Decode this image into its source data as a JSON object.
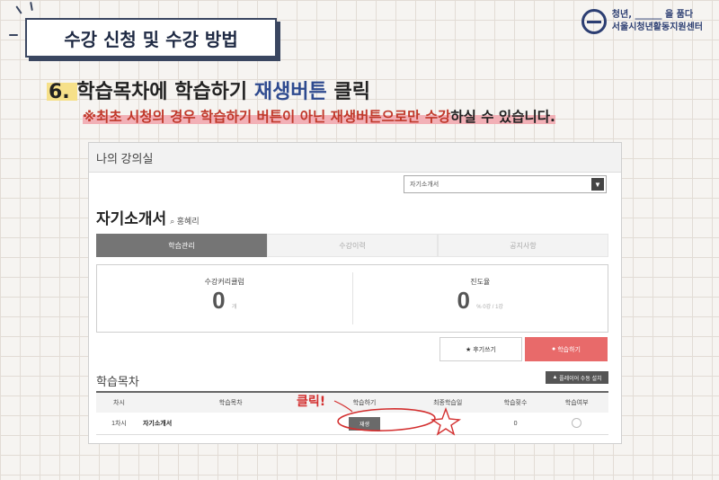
{
  "slide": {
    "title": "수강 신청 및 수강 방법",
    "logo": {
      "line1": "청년, ______ 을 품다",
      "line2": "서울시청년활동지원센터"
    },
    "heading": {
      "number": "6.",
      "prefix": "학습목차에 학습하기 ",
      "accent": "재생버튼",
      "suffix": " 클릭"
    },
    "note": {
      "warn": "※최초 시청의 경우 학습하기 버튼이 아닌 재생버튼으로만 수강",
      "rest": "하실 수 있습니다."
    },
    "click_label": "클릭!"
  },
  "panel": {
    "header": "나의 강의실",
    "course_select": "자기소개서",
    "course_title": "자기소개서",
    "teacher": "홍혜리",
    "tabs": [
      "학습관리",
      "수강이력",
      "공지사항"
    ],
    "stats": [
      {
        "label": "수강커리큘럼",
        "value": "0",
        "unit": "개"
      },
      {
        "label": "진도율",
        "value": "0",
        "unit": "% 0강 / 1강"
      }
    ],
    "review_button": "후기쓰기",
    "study_button": "학습하기",
    "toc_title": "학습목차",
    "player_button": "플레이어 수동 설치",
    "columns": [
      "차시",
      "학습목차",
      "학습하기",
      "최종학습일",
      "학습횟수",
      "학습여부"
    ],
    "rows": [
      {
        "session": "1차시",
        "lesson": "자기소개서",
        "play": "재생",
        "last": "",
        "count": "0"
      }
    ]
  },
  "colors": {
    "accent": "#2e4a8f",
    "warn": "#c0392b",
    "highlight": "#f2b0b6",
    "annotation": "#d32f2f"
  },
  "icons": [
    "search-icon",
    "chevron-down-icon",
    "star-icon",
    "play-icon",
    "check-circle-icon",
    "logo-icon"
  ]
}
